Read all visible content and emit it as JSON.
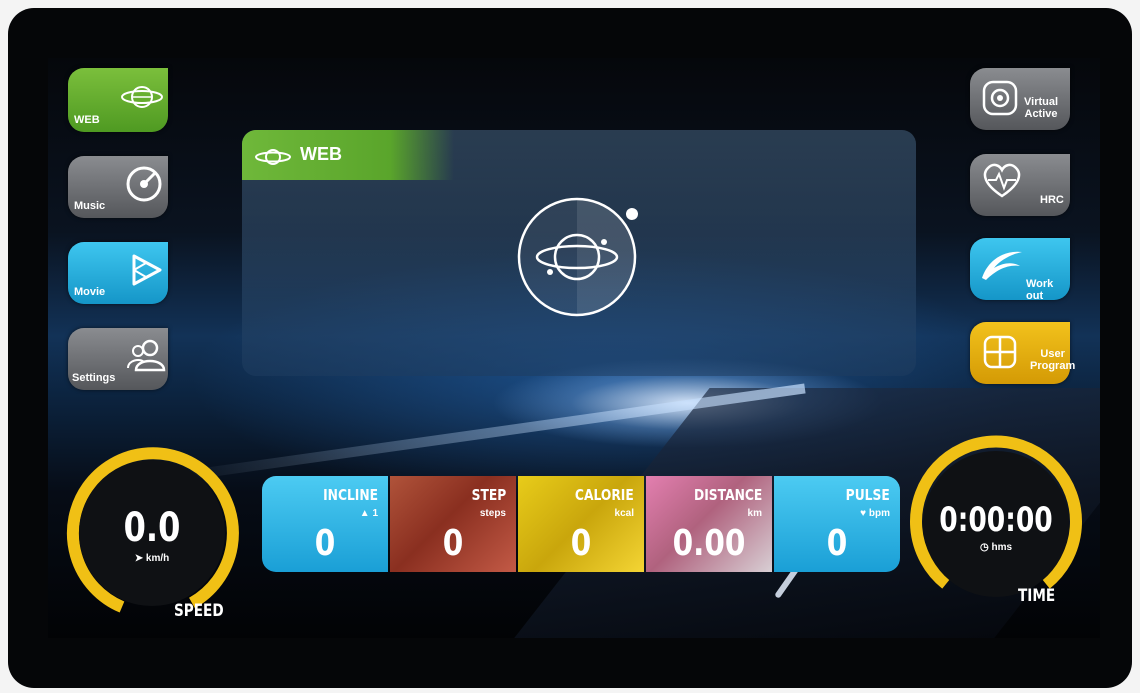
{
  "left_menu": [
    {
      "label": "WEB",
      "icon": "planet-icon"
    },
    {
      "label": "Music",
      "icon": "music-disc-icon"
    },
    {
      "label": "Movie",
      "icon": "play-icon"
    },
    {
      "label": "Settings",
      "icon": "users-icon"
    }
  ],
  "right_menu": [
    {
      "label_1": "Virtual",
      "label_2": "Active",
      "icon": "virtual-active-icon"
    },
    {
      "label": "HRC",
      "icon": "heart-rate-icon"
    },
    {
      "label": "Work out",
      "icon": "wave-icon"
    },
    {
      "label_1": "User",
      "label_2": "Program",
      "icon": "grid-icon"
    }
  ],
  "panel": {
    "title": "WEB",
    "icon": "planet-icon"
  },
  "speed": {
    "value": "0.0",
    "unit": "km/h",
    "caption": "SPEED",
    "level": 0
  },
  "time": {
    "value": "0:00:00",
    "unit": "hms",
    "caption": "TIME",
    "level": 0
  },
  "metrics": [
    {
      "name": "INCLINE",
      "unit": "1",
      "value": "0"
    },
    {
      "name": "STEP",
      "unit": "steps",
      "value": "0"
    },
    {
      "name": "CALORIE",
      "unit": "kcal",
      "value": "0"
    },
    {
      "name": "DISTANCE",
      "unit": "km",
      "value": "0.00"
    },
    {
      "name": "PULSE",
      "unit": "bpm",
      "value": "0"
    }
  ],
  "colors": {
    "green": "#6fb83a",
    "blue": "#2bb2e3",
    "yellow": "#f0c015",
    "gray": "#6e7074"
  }
}
